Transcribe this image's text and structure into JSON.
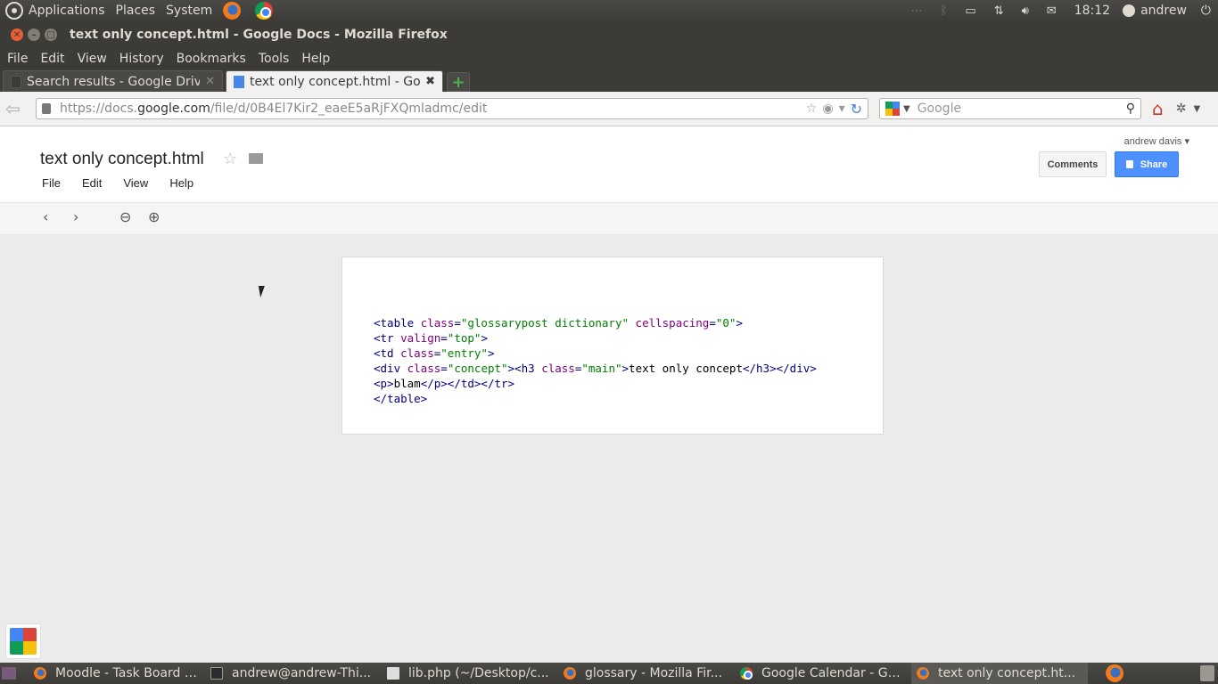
{
  "gnome_panel": {
    "menus": [
      "Applications",
      "Places",
      "System"
    ],
    "clock": "18:12",
    "user": "andrew"
  },
  "window": {
    "title": "text only concept.html - Google Docs - Mozilla Firefox"
  },
  "firefox_menu": [
    "File",
    "Edit",
    "View",
    "History",
    "Bookmarks",
    "Tools",
    "Help"
  ],
  "tabs": [
    {
      "label": "Search results - Google Drive",
      "active": false
    },
    {
      "label": "text only concept.html - Go...",
      "active": true
    }
  ],
  "address_bar": {
    "url_prefix": "https://docs.",
    "url_domain": "google.com",
    "url_path": "/file/d/0B4El7Kir2_eaeE5aRjFXQmladmc/edit"
  },
  "search_bar": {
    "placeholder": "Google"
  },
  "docs": {
    "title": "text only concept.html",
    "menu": [
      "File",
      "Edit",
      "View",
      "Help"
    ],
    "account": "andrew davis",
    "comments_label": "Comments",
    "share_label": "Share"
  },
  "code_lines": [
    "<table class=\"glossarypost dictionary\" cellspacing=\"0\">",
    "<tr valign=\"top\">",
    "<td class=\"entry\">",
    "<div class=\"concept\"><h3 class=\"main\">text only concept</h3></div>",
    "<p>blam</p></td></tr>",
    "</table>"
  ],
  "taskbar": [
    {
      "label": "Moodle - Task Board -...",
      "icon": "firefox-icon"
    },
    {
      "label": "andrew@andrew-Thi...",
      "icon": "terminal-icon"
    },
    {
      "label": "lib.php (~/Desktop/c...",
      "icon": "text-editor-icon"
    },
    {
      "label": "glossary - Mozilla Fir...",
      "icon": "firefox-icon"
    },
    {
      "label": "Google Calendar - Go...",
      "icon": "chrome-icon"
    },
    {
      "label": "text only concept.ht...",
      "icon": "firefox-icon"
    }
  ]
}
